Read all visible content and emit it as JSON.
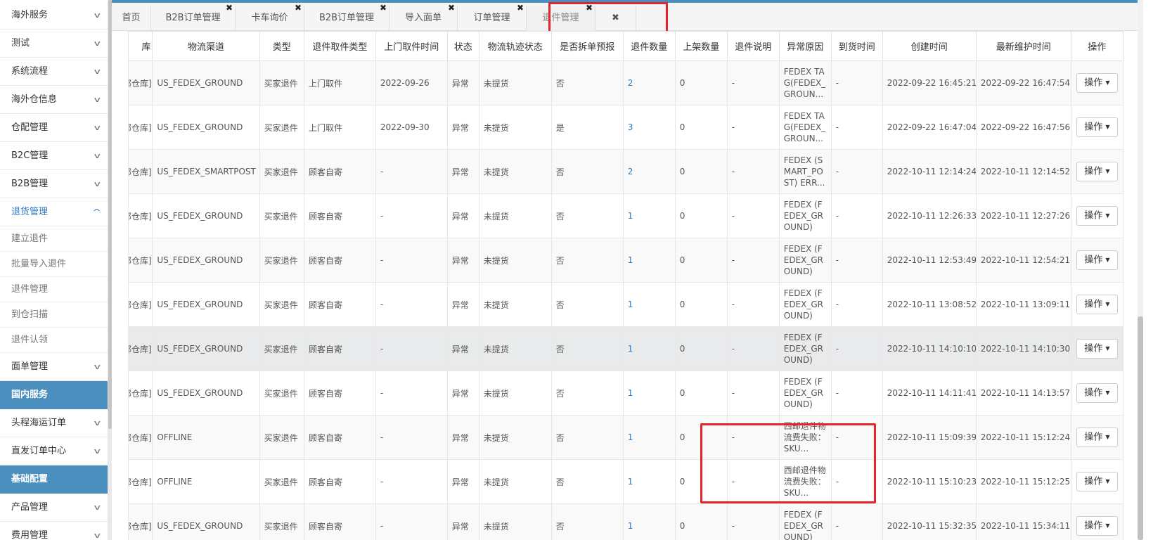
{
  "sidebar": {
    "items": [
      {
        "label": "海外服务",
        "type": "group"
      },
      {
        "label": "测试",
        "type": "group"
      },
      {
        "label": "系统流程",
        "type": "group"
      },
      {
        "label": "海外仓信息",
        "type": "group"
      },
      {
        "label": "仓配管理",
        "type": "group"
      },
      {
        "label": "B2C管理",
        "type": "group"
      },
      {
        "label": "B2B管理",
        "type": "group"
      },
      {
        "label": "退货管理",
        "type": "group",
        "active": true
      },
      {
        "label": "建立退件",
        "type": "sub"
      },
      {
        "label": "批量导入退件",
        "type": "sub"
      },
      {
        "label": "退件管理",
        "type": "sub"
      },
      {
        "label": "到仓扫描",
        "type": "sub"
      },
      {
        "label": "退件认领",
        "type": "sub"
      },
      {
        "label": "面单管理",
        "type": "group"
      },
      {
        "label": "国内服务",
        "type": "section"
      },
      {
        "label": "头程海运订单",
        "type": "group"
      },
      {
        "label": "直发订单中心",
        "type": "group"
      },
      {
        "label": "基础配置",
        "type": "section"
      },
      {
        "label": "产品管理",
        "type": "group"
      },
      {
        "label": "费用管理",
        "type": "group"
      }
    ]
  },
  "tabs": [
    {
      "label": "首页",
      "closable": false
    },
    {
      "label": "B2B订单管理",
      "closable": true
    },
    {
      "label": "卡车询价",
      "closable": true
    },
    {
      "label": "B2B订单管理",
      "closable": true
    },
    {
      "label": "导入面单",
      "closable": true
    },
    {
      "label": "订单管理",
      "closable": true
    },
    {
      "label": "退件管理",
      "closable": true,
      "active": true
    },
    {
      "label": "✖",
      "closable": false
    }
  ],
  "table": {
    "columns": [
      "库",
      "物流渠道",
      "类型",
      "退件取件类型",
      "上门取件时间",
      "状态",
      "物流轨迹状态",
      "是否拆单预报",
      "退件数量",
      "上架数量",
      "退件说明",
      "异常原因",
      "到货时间",
      "创建时间",
      "最新维护时间",
      "操作"
    ],
    "op_label": "操作",
    "rows": [
      [
        "部仓库]",
        "US_FEDEX_GROUND",
        "买家退件",
        "上门取件",
        "2022-09-26",
        "异常",
        "未提货",
        "否",
        "2",
        "0",
        "-",
        "FEDEX TAG(FEDEX_GROUN...",
        "-",
        "2022-09-22 16:45:21",
        "2022-09-22 16:47:54"
      ],
      [
        "部仓库]",
        "US_FEDEX_GROUND",
        "买家退件",
        "上门取件",
        "2022-09-30",
        "异常",
        "未提货",
        "是",
        "3",
        "0",
        "-",
        "FEDEX TAG(FEDEX_GROUN...",
        "-",
        "2022-09-22 16:47:04",
        "2022-09-22 16:47:56"
      ],
      [
        "部仓库]",
        "US_FEDEX_SMARTPOST",
        "买家退件",
        "顾客自寄",
        "-",
        "异常",
        "未提货",
        "否",
        "2",
        "0",
        "-",
        "FEDEX (SMART_POST) ERR...",
        "-",
        "2022-10-11 12:14:24",
        "2022-10-11 12:14:52"
      ],
      [
        "部仓库]",
        "US_FEDEX_GROUND",
        "买家退件",
        "顾客自寄",
        "-",
        "异常",
        "未提货",
        "否",
        "1",
        "0",
        "-",
        "FEDEX (FEDEX_GROUND) E...",
        "-",
        "2022-10-11 12:26:33",
        "2022-10-11 12:27:26"
      ],
      [
        "部仓库]",
        "US_FEDEX_GROUND",
        "买家退件",
        "顾客自寄",
        "-",
        "异常",
        "未提货",
        "否",
        "1",
        "0",
        "-",
        "FEDEX (FEDEX_GROUND) E...",
        "-",
        "2022-10-11 12:53:49",
        "2022-10-11 12:54:21"
      ],
      [
        "部仓库]",
        "US_FEDEX_GROUND",
        "买家退件",
        "顾客自寄",
        "-",
        "异常",
        "未提货",
        "否",
        "1",
        "0",
        "-",
        "FEDEX (FEDEX_GROUND) E...",
        "-",
        "2022-10-11 13:08:52",
        "2022-10-11 13:09:11"
      ],
      [
        "部仓库]",
        "US_FEDEX_GROUND",
        "买家退件",
        "顾客自寄",
        "-",
        "异常",
        "未提货",
        "否",
        "1",
        "0",
        "-",
        "FEDEX (FEDEX_GROUND) E...",
        "-",
        "2022-10-11 14:10:10",
        "2022-10-11 14:10:30"
      ],
      [
        "部仓库]",
        "US_FEDEX_GROUND",
        "买家退件",
        "顾客自寄",
        "-",
        "异常",
        "未提货",
        "否",
        "1",
        "0",
        "-",
        "FEDEX (FEDEX_GROUND) E...",
        "-",
        "2022-10-11 14:11:41",
        "2022-10-11 14:13:57"
      ],
      [
        "部仓库]",
        "OFFLINE",
        "买家退件",
        "顾客自寄",
        "-",
        "异常",
        "未提货",
        "否",
        "1",
        "0",
        "-",
        "西邮退件物流费失败：SKU...",
        "-",
        "2022-10-11 15:09:39",
        "2022-10-11 15:12:24"
      ],
      [
        "部仓库]",
        "OFFLINE",
        "买家退件",
        "顾客自寄",
        "-",
        "异常",
        "未提货",
        "否",
        "1",
        "0",
        "-",
        "西邮退件物流费失败：SKU...",
        "-",
        "2022-10-11 15:10:23",
        "2022-10-11 15:12:25"
      ],
      [
        "部仓库]",
        "US_FEDEX_GROUND",
        "买家退件",
        "顾客自寄",
        "-",
        "异常",
        "未提货",
        "否",
        "1",
        "0",
        "-",
        "FEDEX (FEDEX_GROUND) E...",
        "-",
        "2022-10-11 15:32:35",
        "2022-10-11 15:34:11"
      ]
    ],
    "hover_row": 6
  },
  "colors": {
    "accent": "#4b8fbf",
    "link": "#2d7bc4",
    "highlight": "#e3242b"
  }
}
